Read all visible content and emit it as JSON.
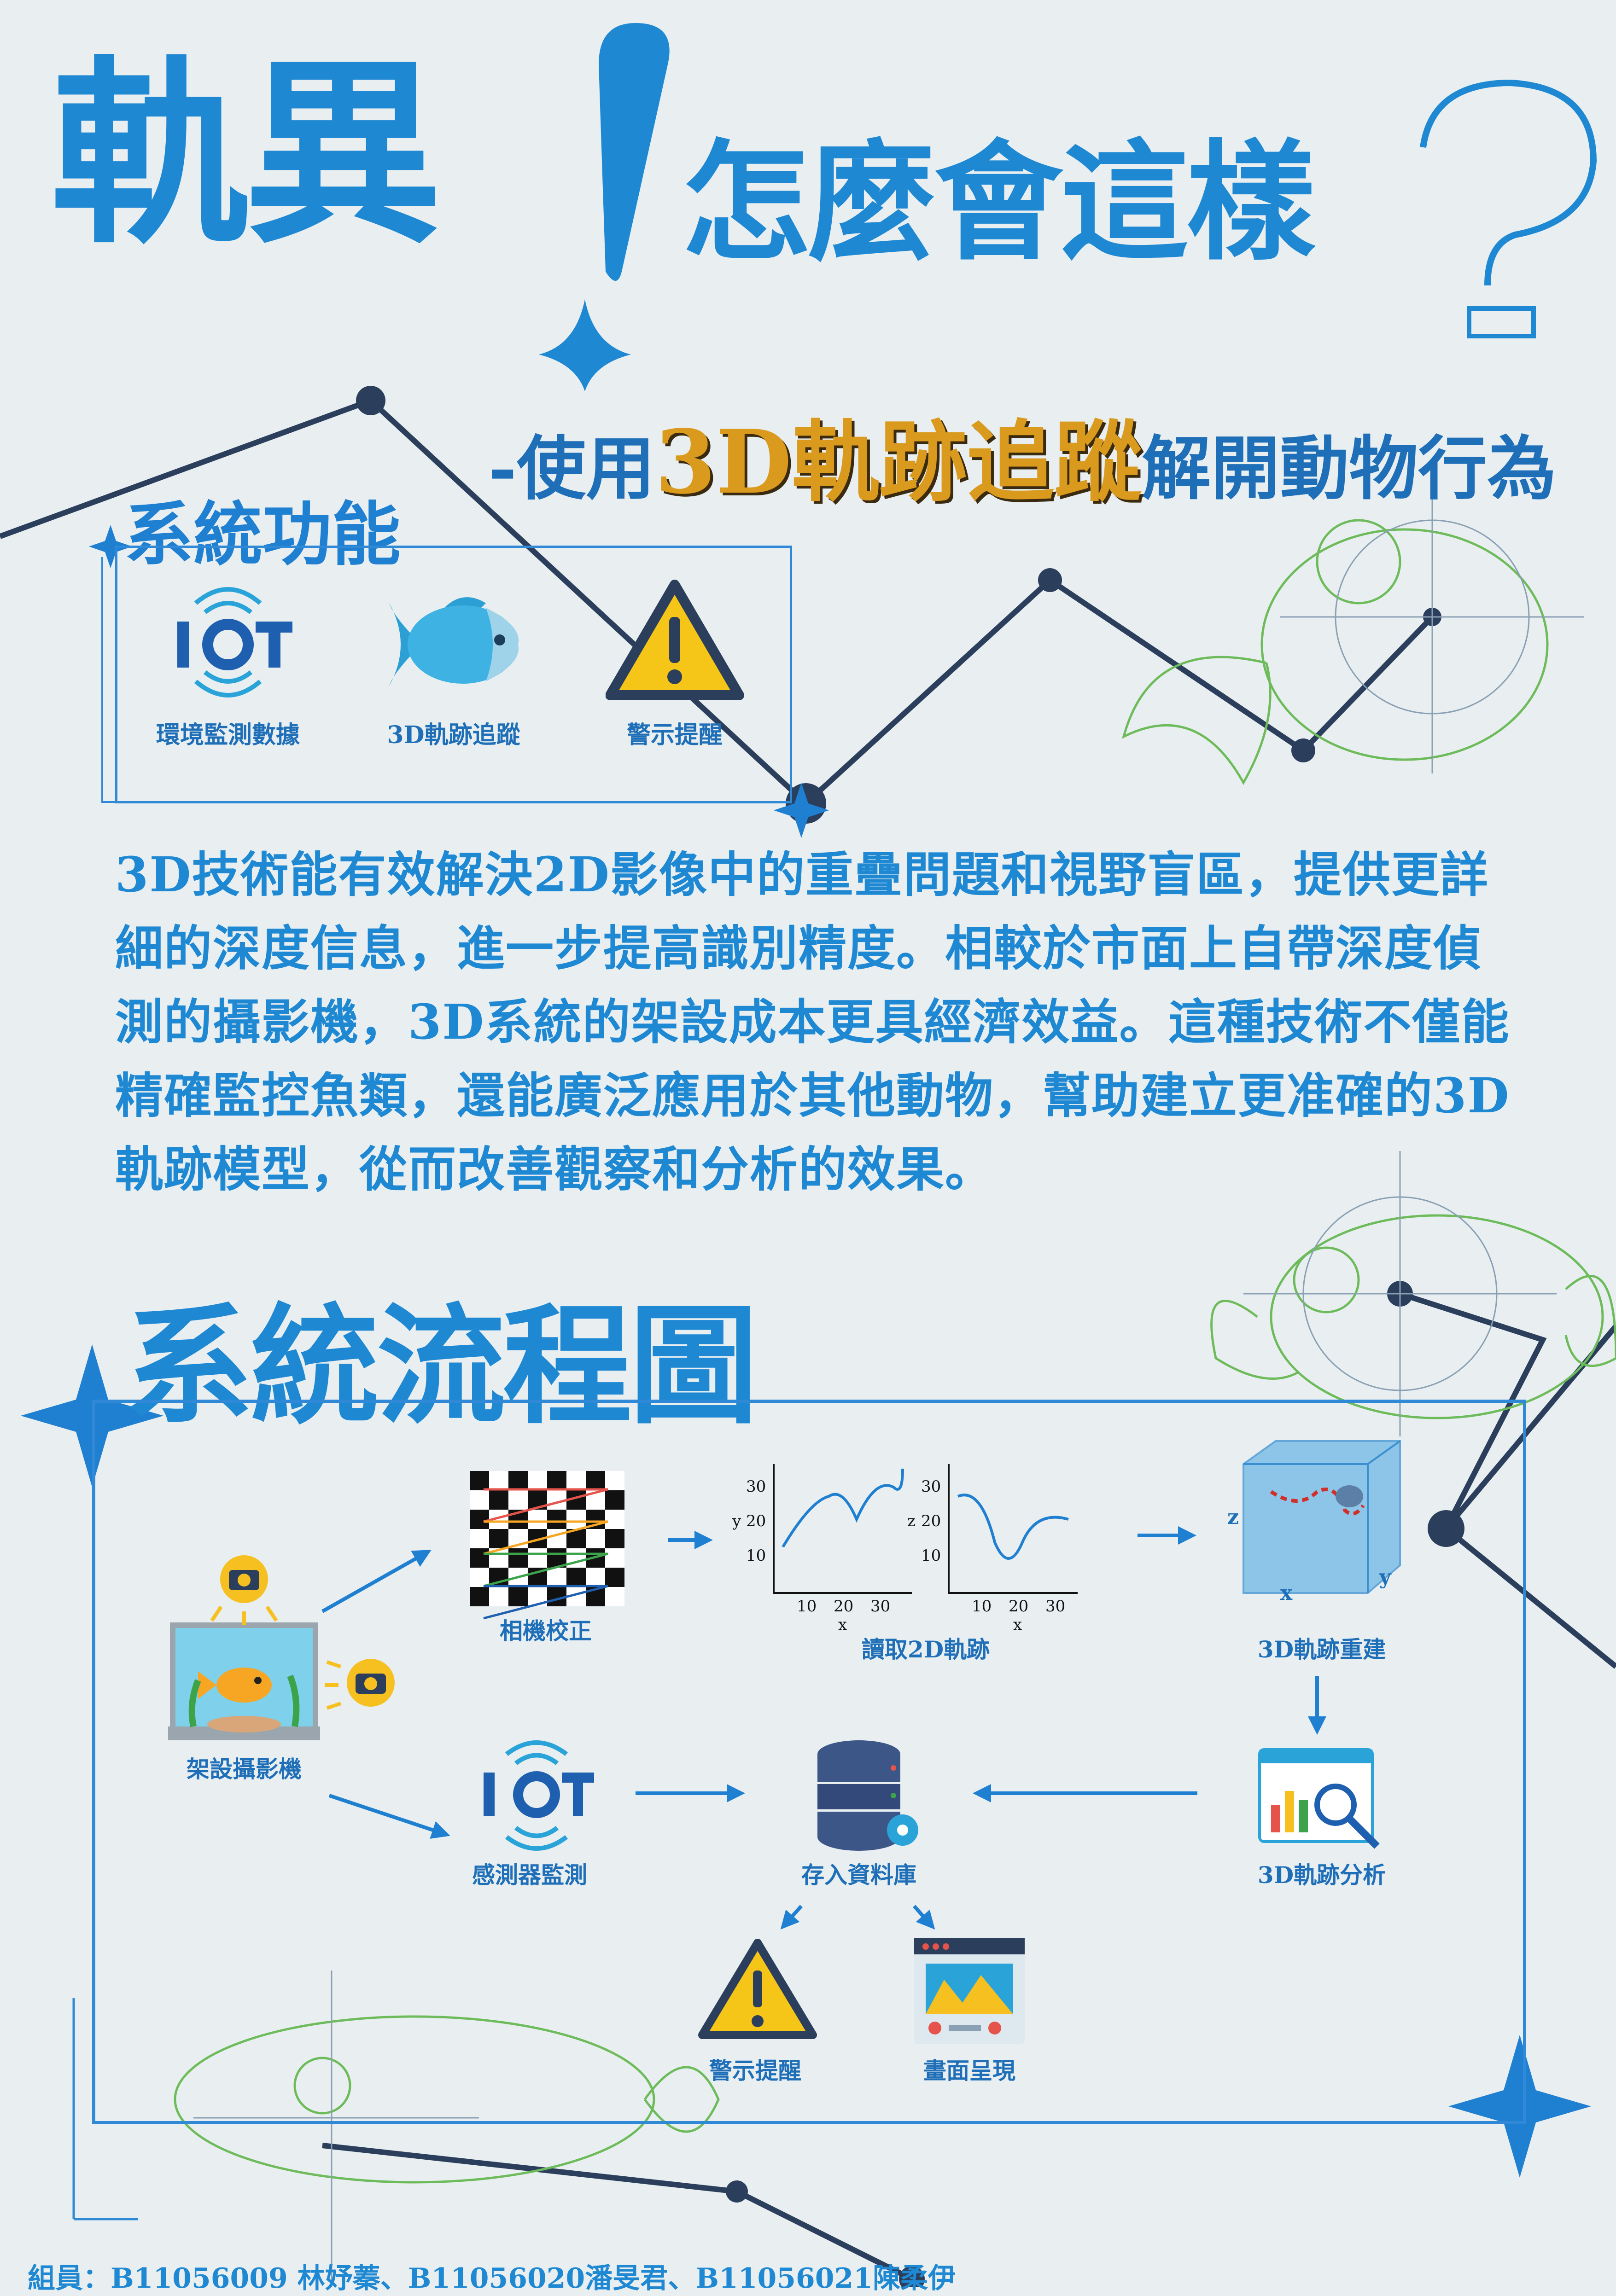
{
  "title": {
    "main": "軌異",
    "sub": "怎麼會這樣",
    "tagline_prefix": "-使用",
    "tagline_highlight": "3D軌跡追蹤",
    "tagline_suffix": "解開動物行為"
  },
  "system_functions": {
    "heading": "系統功能",
    "items": [
      {
        "icon": "iot-icon",
        "label": "環境監測數據"
      },
      {
        "icon": "fish-icon",
        "label": "3D軌跡追蹤"
      },
      {
        "icon": "warning-icon",
        "label": "警示提醒"
      }
    ]
  },
  "description": "3D技術能有效解決2D影像中的重疊問題和視野盲區，提供更詳細的深度信息，進一步提高識別精度。相較於市面上自帶深度偵測的攝影機，3D系統的架設成本更具經濟效益。這種技術不僅能精確監控魚類，還能廣泛應用於其他動物，幫助建立更准確的3D軌跡模型，從而改善觀察和分析的效果。",
  "flowchart": {
    "heading": "系統流程圖",
    "nodes": {
      "setup_camera": "架設攝影機",
      "camera_calibration": "相機校正",
      "read_2d": "讀取2D軌跡",
      "reconstruct_3d": "3D軌跡重建",
      "analyze_3d": "3D軌跡分析",
      "sensor": "感測器監測",
      "database": "存入資料庫",
      "alert": "警示提醒",
      "display": "畫面呈現"
    },
    "plot_ticks": {
      "y": [
        "30",
        "20",
        "10"
      ],
      "x": [
        "10",
        "20",
        "30"
      ],
      "x_label": "x",
      "y_label_1": "y",
      "y_label_2": "z"
    },
    "axes_3d": {
      "z": "z",
      "x": "x",
      "y": "y"
    }
  },
  "credit": "組員：B11056009 林妤蓁、B11056020潘旻君、B11056021陳柔伊",
  "colors": {
    "primary": "#1f88d3",
    "dark_line": "#2b3e5c",
    "highlight": "#d99a1e",
    "fish_line": "#6dbb5a"
  }
}
